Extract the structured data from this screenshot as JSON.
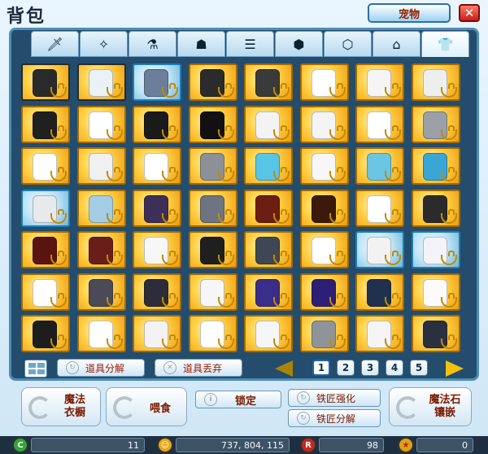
{
  "window": {
    "title": "背包",
    "pet_button": "宠物",
    "close_symbol": "✕"
  },
  "tabs": [
    {
      "name": "weapon",
      "icon": "sword-icon",
      "glyph": "🗡"
    },
    {
      "name": "accessory",
      "icon": "sparkle-icon",
      "glyph": "✧"
    },
    {
      "name": "potion",
      "icon": "flask-icon",
      "glyph": "⚗"
    },
    {
      "name": "bag",
      "icon": "moneybag-icon",
      "glyph": "☗"
    },
    {
      "name": "scroll",
      "icon": "scroll-icon",
      "glyph": "☰"
    },
    {
      "name": "box-star",
      "icon": "box-star-icon",
      "glyph": "⬢"
    },
    {
      "name": "box",
      "icon": "box-icon",
      "glyph": "⬡"
    },
    {
      "name": "home",
      "icon": "home-icon",
      "glyph": "⌂"
    },
    {
      "name": "costume",
      "icon": "shirt-icon",
      "glyph": "👕",
      "active": true
    }
  ],
  "grid": {
    "rows": [
      [
        {
          "c": "#2a2a2a",
          "f": "dark"
        },
        {
          "c": "#e9f2f7",
          "f": "dark"
        },
        {
          "c": "#6b7f9a",
          "f": "blue"
        },
        {
          "c": "#2b2b2b"
        },
        {
          "c": "#3a3a3a"
        },
        {
          "c": "#ffffff"
        },
        {
          "c": "#f5f5f5"
        },
        {
          "c": "#eeeeee"
        }
      ],
      [
        {
          "c": "#202020"
        },
        {
          "c": "#ffffff"
        },
        {
          "c": "#1a1a1a"
        },
        {
          "c": "#111111"
        },
        {
          "c": "#f3f3f3"
        },
        {
          "c": "#f4f4f4"
        },
        {
          "c": "#ffffff"
        },
        {
          "c": "#9aa0a6"
        }
      ],
      [
        {
          "c": "#ffffff"
        },
        {
          "c": "#f0f0f0"
        },
        {
          "c": "#ffffff"
        },
        {
          "c": "#8c9099"
        },
        {
          "c": "#57c5e6"
        },
        {
          "c": "#f7f7f7"
        },
        {
          "c": "#6cc5e2"
        },
        {
          "c": "#3aa6d6"
        }
      ],
      [
        {
          "c": "#e6eaec",
          "f": "blue"
        },
        {
          "c": "#a4cde4"
        },
        {
          "c": "#3d2f57"
        },
        {
          "c": "#6e7480"
        },
        {
          "c": "#6b1e12"
        },
        {
          "c": "#3b1a0c"
        },
        {
          "c": "#ffffff"
        },
        {
          "c": "#2b2b2b"
        }
      ],
      [
        {
          "c": "#5a1410"
        },
        {
          "c": "#6a1e1a"
        },
        {
          "c": "#f7f7f7"
        },
        {
          "c": "#1f1f1f"
        },
        {
          "c": "#3f4754"
        },
        {
          "c": "#ffffff"
        },
        {
          "c": "#f2f2f2",
          "f": "blue"
        },
        {
          "c": "#f4f4f8",
          "f": "blue"
        }
      ],
      [
        {
          "c": "#ffffff"
        },
        {
          "c": "#4b4b58"
        },
        {
          "c": "#2c2c3a"
        },
        {
          "c": "#f6f6f6"
        },
        {
          "c": "#3a2e8a"
        },
        {
          "c": "#2d1f75"
        },
        {
          "c": "#20304f"
        },
        {
          "c": "#fbfbfb"
        }
      ],
      [
        {
          "c": "#1d1d1d"
        },
        {
          "c": "#ffffff"
        },
        {
          "c": "#f3f3f3"
        },
        {
          "c": "#ffffff"
        },
        {
          "c": "#f6f6f6"
        },
        {
          "c": "#8e949a"
        },
        {
          "c": "#f5f5f5"
        },
        {
          "c": "#2a3040"
        }
      ]
    ]
  },
  "toolbar": {
    "decompose": "道具分解",
    "discard": "道具丢弃",
    "pages": [
      "1",
      "2",
      "3",
      "4",
      "5"
    ],
    "current_page": "1"
  },
  "functions": {
    "magic_wardrobe_l1": "魔法",
    "magic_wardrobe_l2": "衣橱",
    "feed": "喂食",
    "lock": "锁定",
    "smith_enhance": "铁匠强化",
    "smith_decompose": "铁匠分解",
    "magic_stone_l1": "魔法石",
    "magic_stone_l2": "镶嵌"
  },
  "status": {
    "green_value": "11",
    "gold_value": "737, 804, 115",
    "red_value": "98",
    "star_value": "0",
    "green_glyph": "C",
    "gold_glyph": "☺",
    "red_glyph": "R",
    "star_glyph": "★"
  },
  "colors": {
    "slot_gold": "#f2b01e",
    "slot_blue": "#8ec8e8",
    "panel_navy": "#234c6d",
    "accent_red": "#9c1800"
  }
}
